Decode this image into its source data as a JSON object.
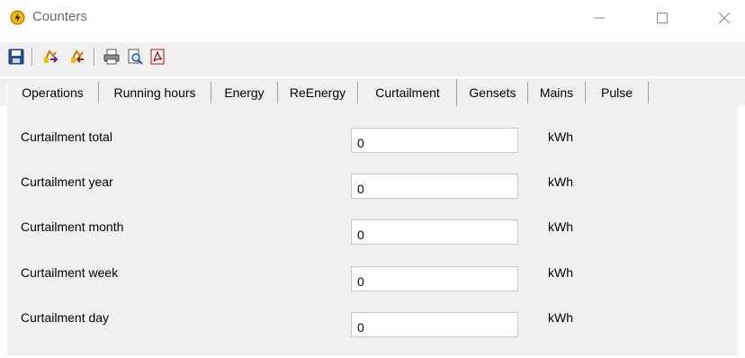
{
  "window": {
    "title": "Counters"
  },
  "toolbar": {
    "icons": [
      "save-icon",
      "export-icon",
      "import-icon",
      "print-icon",
      "print-preview-icon",
      "pdf-icon"
    ]
  },
  "tabs": [
    {
      "label": "Operations"
    },
    {
      "label": "Running hours"
    },
    {
      "label": "Energy"
    },
    {
      "label": "ReEnergy"
    },
    {
      "label": "Curtailment",
      "active": true
    },
    {
      "label": "Gensets"
    },
    {
      "label": "Mains"
    },
    {
      "label": "Pulse"
    }
  ],
  "rows": [
    {
      "label": "Curtailment total",
      "value": "0",
      "unit": "kWh"
    },
    {
      "label": "Curtailment year",
      "value": "0",
      "unit": "kWh"
    },
    {
      "label": "Curtailment month",
      "value": "0",
      "unit": "kWh"
    },
    {
      "label": "Curtailment week",
      "value": "0",
      "unit": "kWh"
    },
    {
      "label": "Curtailment day",
      "value": "0",
      "unit": "kWh"
    }
  ],
  "colors": {
    "panel": "#f0f0f0",
    "title_text": "#6a6a6a",
    "app_icon": "#f2b705"
  }
}
